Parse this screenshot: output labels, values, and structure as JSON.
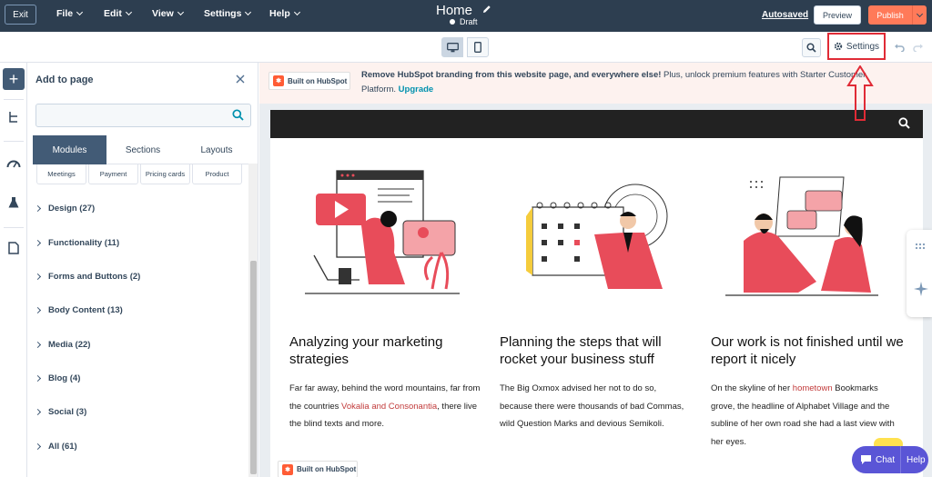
{
  "topbar": {
    "exit": "Exit",
    "menus": [
      "File",
      "Edit",
      "View",
      "Settings",
      "Help"
    ],
    "page_title": "Home",
    "status": "Draft",
    "autosaved": "Autosaved",
    "preview": "Preview",
    "publish": "Publish"
  },
  "toolbar": {
    "settings": "Settings"
  },
  "panel": {
    "title": "Add to page",
    "search_placeholder": "",
    "tabs": [
      "Modules",
      "Sections",
      "Layouts"
    ],
    "module_cards": [
      "Meetings",
      "Payment",
      "Pricing cards",
      "Product"
    ],
    "categories": [
      "Design (27)",
      "Functionality (11)",
      "Forms and Buttons (2)",
      "Body Content (13)",
      "Media (22)",
      "Blog (4)",
      "Social (3)",
      "All (61)"
    ]
  },
  "banner": {
    "badge": "Built on HubSpot",
    "message_bold": "Remove HubSpot branding from this website page, and everywhere else!",
    "message": " Plus, unlock premium features with Starter Customer Platform. ",
    "upgrade": "Upgrade"
  },
  "columns": [
    {
      "title": "Analyzing your marketing strategies",
      "text_a": "Far far away, behind the word mountains, far from the countries ",
      "link": "Vokalia and Consonantia",
      "text_b": ", there live the blind texts and more."
    },
    {
      "title": "Planning the steps that will rocket your business stuff",
      "text_a": "The Big Oxmox advised her not to do so, because there were thousands of bad Commas, wild Question Marks and devious Semikoli.",
      "link": "",
      "text_b": ""
    },
    {
      "title": "Our work is not finished until we report it nicely",
      "text_a": "On the skyline of her ",
      "link": "hometown",
      "text_b": " Bookmarks grove, the headline of Alphabet Village and the subline of her own road she had a last view with her eyes."
    }
  ],
  "footer_badge": "Built on HubSpot",
  "chat": {
    "chat": "Chat",
    "help": "Help"
  },
  "colors": {
    "topbar": "#2d3e50",
    "publish": "#ff7a59",
    "accent_red": "#c23b3b",
    "highlight_box": "#e02b36",
    "chat": "#5a55d6"
  }
}
